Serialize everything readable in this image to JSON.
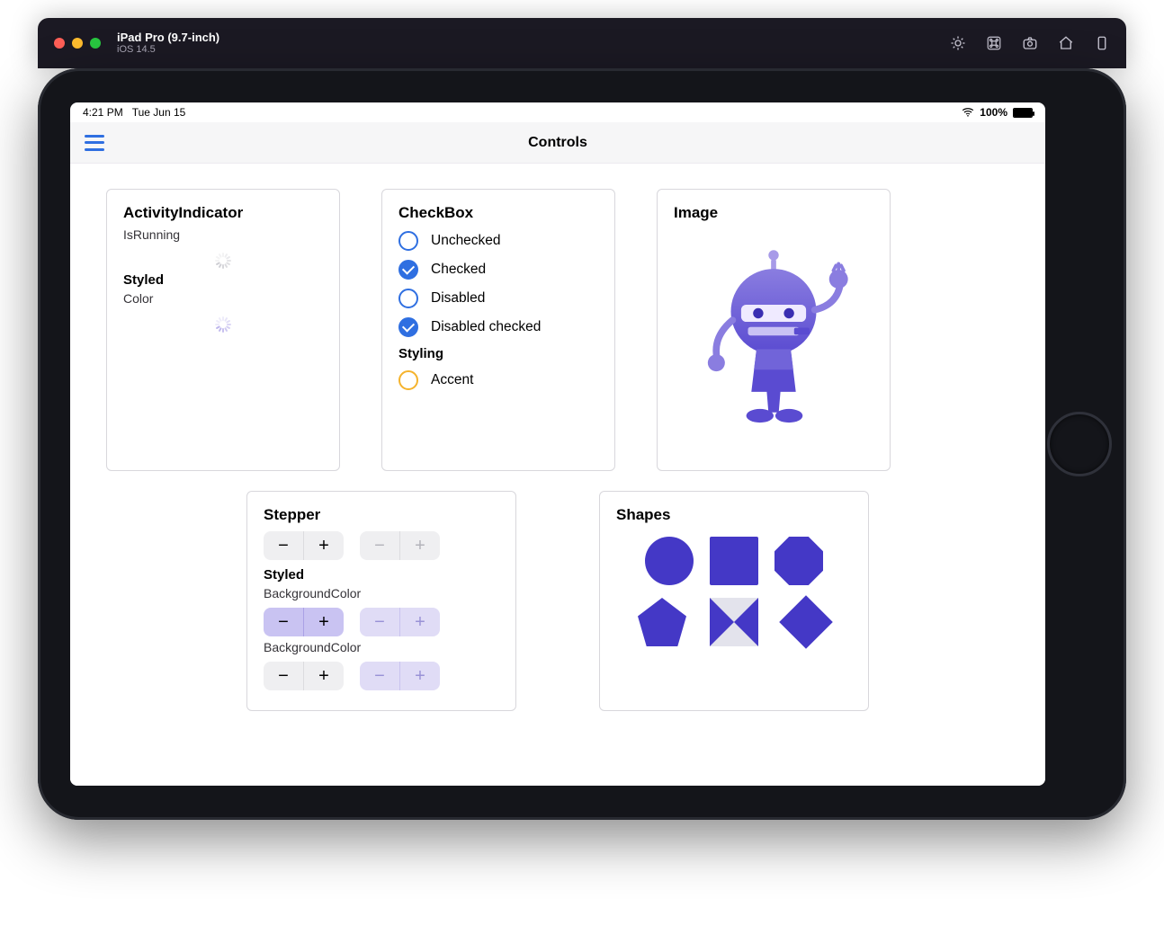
{
  "simulator": {
    "device": "iPad Pro (9.7-inch)",
    "os": "iOS 14.5"
  },
  "statusbar": {
    "time": "4:21 PM",
    "date": "Tue Jun 15",
    "battery_pct": "100%"
  },
  "nav": {
    "title": "Controls"
  },
  "activity": {
    "title": "ActivityIndicator",
    "prop1": "IsRunning",
    "subhead": "Styled",
    "prop2": "Color"
  },
  "checkbox": {
    "title": "CheckBox",
    "items": [
      {
        "label": "Unchecked",
        "checked": false
      },
      {
        "label": "Checked",
        "checked": true
      },
      {
        "label": "Disabled",
        "checked": false
      },
      {
        "label": "Disabled checked",
        "checked": true
      }
    ],
    "subhead": "Styling",
    "accent_label": "Accent"
  },
  "image": {
    "title": "Image"
  },
  "stepper": {
    "title": "Stepper",
    "subhead": "Styled",
    "prop1": "BackgroundColor",
    "prop2": "BackgroundColor",
    "minus": "−",
    "plus": "+"
  },
  "shapes": {
    "title": "Shapes"
  },
  "colors": {
    "accent_blue": "#2f6fe1",
    "accent_orange": "#f5b32c",
    "brand_purple": "#4438c6",
    "purple_tint": "#c9c3f2"
  }
}
